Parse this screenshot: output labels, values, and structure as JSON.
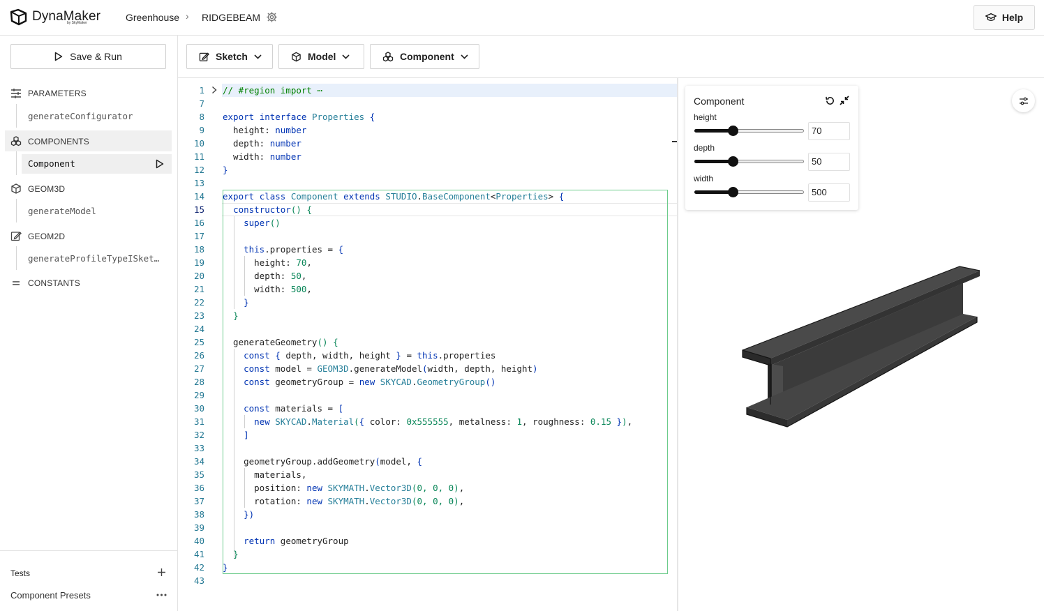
{
  "app": {
    "logo_text": "DynaMaker",
    "logo_sub": "by SkyMaker"
  },
  "breadcrumb": {
    "project": "Greenhouse",
    "component": "RIDGEBEAM"
  },
  "header": {
    "help_label": "Help"
  },
  "sidebar": {
    "save_run_label": "Save & Run",
    "sections": [
      {
        "label": "PARAMETERS",
        "items": [
          "generateConfigurator"
        ]
      },
      {
        "label": "COMPONENTS",
        "items": [
          "Component"
        ]
      },
      {
        "label": "GEOM3D",
        "items": [
          "generateModel"
        ]
      },
      {
        "label": "GEOM2D",
        "items": [
          "generateProfileTypeISket…"
        ]
      },
      {
        "label": "CONSTANTS",
        "items": []
      }
    ],
    "tests_label": "Tests",
    "presets_label": "Component Presets"
  },
  "toolbar": {
    "sketch": "Sketch",
    "model": "Model",
    "component": "Component"
  },
  "editor": {
    "line_numbers": [
      "1",
      "7",
      "8",
      "9",
      "10",
      "11",
      "12",
      "13",
      "14",
      "15",
      "16",
      "17",
      "18",
      "19",
      "20",
      "21",
      "22",
      "23",
      "24",
      "25",
      "26",
      "27",
      "28",
      "29",
      "30",
      "31",
      "32",
      "33",
      "34",
      "35",
      "36",
      "37",
      "38",
      "39",
      "40",
      "41",
      "42",
      "43"
    ],
    "fold_text": "⋯"
  },
  "component_panel": {
    "title": "Component",
    "params": [
      {
        "label": "height",
        "value": "70",
        "slider_fraction": 0.35
      },
      {
        "label": "depth",
        "value": "50",
        "slider_fraction": 0.35
      },
      {
        "label": "width",
        "value": "500",
        "slider_fraction": 0.35
      }
    ]
  },
  "colors": {
    "accent_green": "#6ccb8b",
    "keyword": "#0033b3",
    "type": "#267f99",
    "number": "#098658",
    "comment": "#008000",
    "line_number": "#237893"
  },
  "icons": [
    "dynamaker-logo-icon",
    "chevron-right-icon",
    "gear-icon",
    "graduation-cap-icon",
    "play-icon",
    "sliders-icon",
    "cubes-icon",
    "cube-icon",
    "edit-icon",
    "equals-icon",
    "plus-icon",
    "more-icon",
    "chevron-down-icon",
    "reset-icon",
    "collapse-icon",
    "settings-icon"
  ]
}
